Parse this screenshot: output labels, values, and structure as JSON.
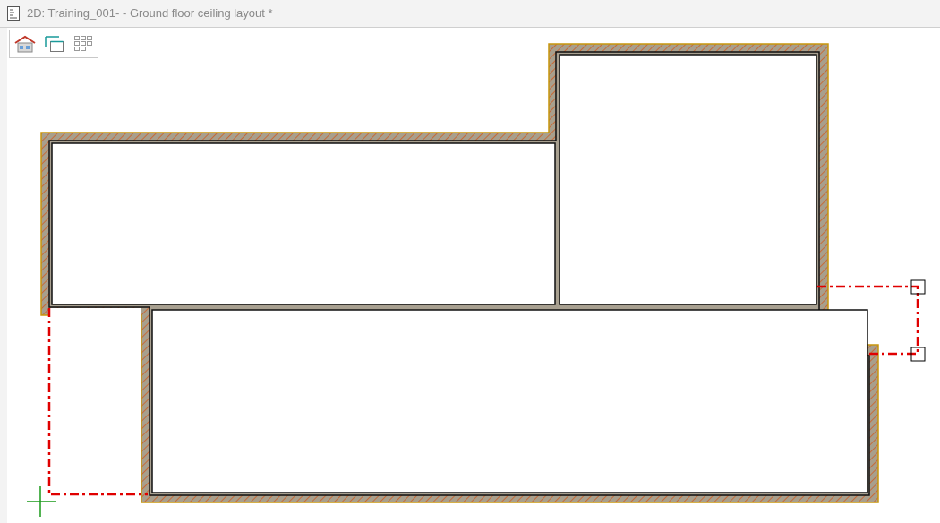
{
  "window": {
    "title": "2D: Training_001- - Ground floor ceiling layout *"
  }
}
